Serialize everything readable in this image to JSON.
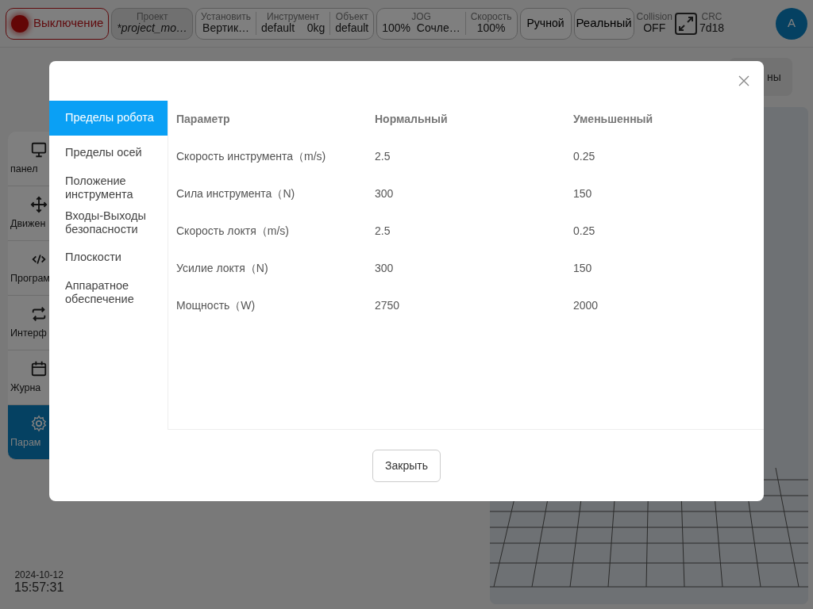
{
  "topbar": {
    "power_button": {
      "label": "Выключение",
      "on": true
    },
    "groups": [
      {
        "cells": [
          {
            "caption": "Проект",
            "value": "*project_mo…",
            "italic": true
          }
        ],
        "kind": "grey"
      },
      {
        "cells": [
          {
            "caption": "Установить",
            "value": "Вертик…"
          },
          {
            "caption": "Инструмент",
            "value": "default    0kg"
          },
          {
            "caption": "Объект",
            "value": "default"
          }
        ],
        "kind": "plain"
      },
      {
        "cells": [
          {
            "caption": "JOG",
            "value": "100%  Сочле…"
          },
          {
            "caption": "Скорость",
            "value": "100%"
          }
        ],
        "kind": "plain"
      }
    ],
    "mode_buttons": [
      "Ручной",
      "Реальный"
    ],
    "collision": {
      "caption": "Collision",
      "value": "OFF"
    },
    "crc": {
      "caption": "CRC",
      "value": "7d18"
    },
    "avatar": "A"
  },
  "sidebar": {
    "items": [
      {
        "label": "панел",
        "selected": false
      },
      {
        "label": "Движен",
        "selected": false
      },
      {
        "label": "Програм",
        "selected": false
      },
      {
        "label": "Интерф",
        "selected": false
      },
      {
        "label": "Журна",
        "selected": false
      },
      {
        "label": "Парам",
        "selected": true
      }
    ],
    "date": "2024-10-12",
    "time": "15:57:31"
  },
  "header_button": "ны",
  "dialog": {
    "menu": [
      {
        "label": "Пределы робота",
        "selected": true
      },
      {
        "label": "Пределы осей",
        "selected": false
      },
      {
        "label": "Положение инструмента",
        "selected": false
      },
      {
        "label": "Входы-Выходы безопасности",
        "selected": false
      },
      {
        "label": "Плоскости",
        "selected": false
      },
      {
        "label": "Аппаратное обеспечение",
        "selected": false
      }
    ],
    "table": {
      "columns": [
        "Параметр",
        "Нормальный",
        "Уменьшенный"
      ],
      "rows": [
        [
          "Скорость инструмента（m/s)",
          "2.5",
          "0.25"
        ],
        [
          "Сила инструмента（N)",
          "300",
          "150"
        ],
        [
          "Скорость локтя（m/s)",
          "2.5",
          "0.25"
        ],
        [
          "Усилие локтя（N)",
          "300",
          "150"
        ],
        [
          "Мощность（W)",
          "2750",
          "2000"
        ]
      ]
    },
    "close_button": "Закрыть"
  }
}
